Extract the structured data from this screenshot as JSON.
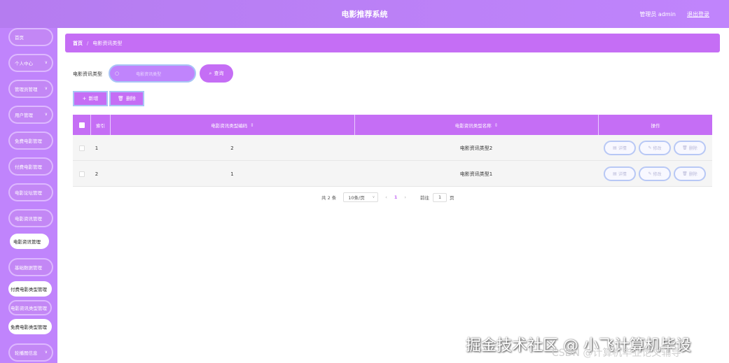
{
  "header": {
    "title": "电影推荐系统",
    "user_text": "管理员 admin",
    "logout_label": "退出登录"
  },
  "sidebar": {
    "items": [
      {
        "label": "首页"
      },
      {
        "label": "个人中心"
      },
      {
        "label": "管理员管理"
      },
      {
        "label": "用户管理"
      },
      {
        "label": "免费电影管理"
      },
      {
        "label": "付费电影管理"
      },
      {
        "label": "电影论坛管理"
      },
      {
        "label": "电影资讯管理"
      },
      {
        "label": "电影资讯管理"
      },
      {
        "label": "基础数据管理"
      },
      {
        "label": "付费电影类型管理"
      },
      {
        "label": "电影资讯类型管理"
      },
      {
        "label": "免费电影类型管理"
      },
      {
        "label": "轮播图信息"
      }
    ]
  },
  "breadcrumb": {
    "home": "首页",
    "separator": "/",
    "current": "电影资讯类型"
  },
  "search": {
    "label": "电影资讯类型",
    "placeholder": "电影资讯类型",
    "query_label": "查询"
  },
  "actions": {
    "add_label": "新增",
    "delete_label": "删除"
  },
  "table": {
    "headers": {
      "index": "索引",
      "code": "电影资讯类型编码",
      "name": "电影资讯类型名称",
      "ops": "操作"
    },
    "rows": [
      {
        "index": "1",
        "code": "2",
        "name": "电影资讯类型2"
      },
      {
        "index": "2",
        "code": "1",
        "name": "电影资讯类型1"
      }
    ],
    "op_labels": {
      "detail": "详情",
      "edit": "修改",
      "delete": "删除"
    }
  },
  "pagination": {
    "total": "共 2 条",
    "page_size": "10条/页",
    "current_page": "1",
    "goto_label": "前往",
    "goto_value": "1",
    "page_suffix": "页"
  },
  "watermarks": {
    "line1": "掘金技术社区 @ 小飞计算机毕设",
    "line2": "CSDN @计算机毕业论文辅导"
  },
  "colors": {
    "accent": "#c56ef5",
    "sidebar": "#c084fc",
    "border_blue": "#a8c5f5"
  }
}
